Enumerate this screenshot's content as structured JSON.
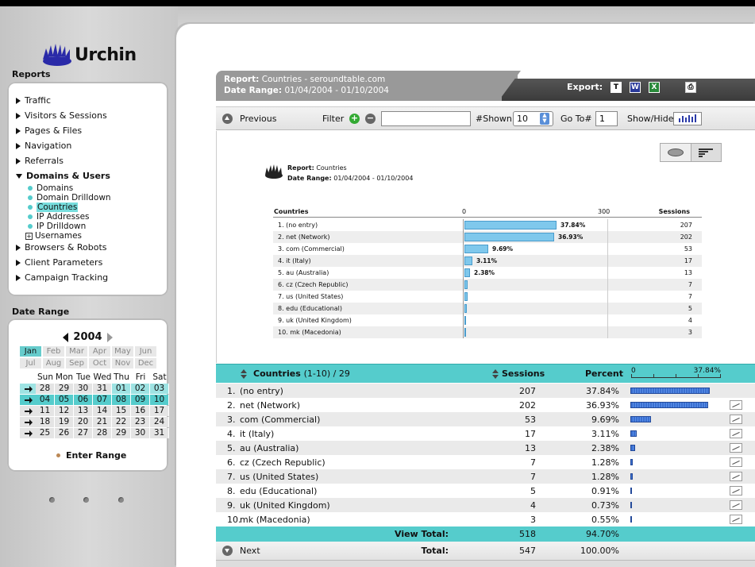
{
  "brand": {
    "name": "Urchin"
  },
  "sidebar": {
    "reports_heading": "Reports",
    "items": [
      {
        "label": "Traffic"
      },
      {
        "label": "Visitors & Sessions"
      },
      {
        "label": "Pages & Files"
      },
      {
        "label": "Navigation"
      },
      {
        "label": "Referrals"
      },
      {
        "label": "Domains & Users"
      },
      {
        "label": "Browsers & Robots"
      },
      {
        "label": "Client Parameters"
      },
      {
        "label": "Campaign Tracking"
      }
    ],
    "subitems": [
      {
        "label": "Domains"
      },
      {
        "label": "Domain Drilldown"
      },
      {
        "label": "Countries"
      },
      {
        "label": "IP Addresses"
      },
      {
        "label": "IP Drilldown"
      },
      {
        "label": "Usernames"
      }
    ],
    "date_range_heading": "Date Range",
    "year": "2004",
    "months": [
      "Jan",
      "Feb",
      "Mar",
      "Apr",
      "May",
      "Jun",
      "Jul",
      "Aug",
      "Sep",
      "Oct",
      "Nov",
      "Dec"
    ],
    "weekdays": [
      "Sun",
      "Mon",
      "Tue",
      "Wed",
      "Thu",
      "Fri",
      "Sat"
    ],
    "weeks": [
      [
        "28",
        "29",
        "30",
        "31",
        "01",
        "02",
        "03"
      ],
      [
        "04",
        "05",
        "06",
        "07",
        "08",
        "09",
        "10"
      ],
      [
        "11",
        "12",
        "13",
        "14",
        "15",
        "16",
        "17"
      ],
      [
        "18",
        "19",
        "20",
        "21",
        "22",
        "23",
        "24"
      ],
      [
        "25",
        "26",
        "27",
        "28",
        "29",
        "30",
        "31"
      ]
    ],
    "enter_range": "Enter Range"
  },
  "header": {
    "report_label": "Report",
    "report_value": "Countries - seroundtable.com",
    "range_label": "Date Range",
    "range_value": "01/04/2004 - 01/10/2004",
    "export_label": "Export:"
  },
  "toolbar": {
    "previous": "Previous",
    "filter": "Filter",
    "filter_value": "",
    "shown_label": "#Shown",
    "shown_value": "10",
    "goto_label": "Go To#",
    "goto_value": "1",
    "showhide": "Show/Hide"
  },
  "chart_data": {
    "type": "bar",
    "report_label": "Report:",
    "report_value": "Countries",
    "range_label": "Date Range:",
    "range_value": "01/04/2004 - 01/10/2004",
    "col_label": "Countries",
    "col_sessions": "Sessions",
    "xlim": [
      0,
      300
    ],
    "tick_labels": [
      "0",
      "300"
    ],
    "categories": [
      "1. (no entry)",
      "2. net (Network)",
      "3. com (Commercial)",
      "4. it (Italy)",
      "5. au (Australia)",
      "6. cz (Czech Republic)",
      "7. us (United States)",
      "8. edu (Educational)",
      "9. uk (United Kingdom)",
      "10. mk (Macedonia)"
    ],
    "values": [
      207,
      202,
      53,
      17,
      13,
      7,
      7,
      5,
      4,
      3
    ],
    "percent_labels": [
      "37.84%",
      "36.93%",
      "9.69%",
      "3.11%",
      "2.38%",
      "",
      "",
      "",
      "",
      ""
    ]
  },
  "table": {
    "col_name": "Countries",
    "col_range": "(1-10) / 29",
    "col_sessions": "Sessions",
    "col_percent": "Percent",
    "scale_min": "0",
    "scale_max": "37.84%",
    "rows": [
      {
        "n": "1.",
        "name": "(no entry)",
        "sessions": "207",
        "percent": "37.84%",
        "pct": 37.84
      },
      {
        "n": "2.",
        "name": "net (Network)",
        "sessions": "202",
        "percent": "36.93%",
        "pct": 36.93
      },
      {
        "n": "3.",
        "name": "com (Commercial)",
        "sessions": "53",
        "percent": "9.69%",
        "pct": 9.69
      },
      {
        "n": "4.",
        "name": "it (Italy)",
        "sessions": "17",
        "percent": "3.11%",
        "pct": 3.11
      },
      {
        "n": "5.",
        "name": "au (Australia)",
        "sessions": "13",
        "percent": "2.38%",
        "pct": 2.38
      },
      {
        "n": "6.",
        "name": "cz (Czech Republic)",
        "sessions": "7",
        "percent": "1.28%",
        "pct": 1.28
      },
      {
        "n": "7.",
        "name": "us (United States)",
        "sessions": "7",
        "percent": "1.28%",
        "pct": 1.28
      },
      {
        "n": "8.",
        "name": "edu (Educational)",
        "sessions": "5",
        "percent": "0.91%",
        "pct": 0.91
      },
      {
        "n": "9.",
        "name": "uk (United Kingdom)",
        "sessions": "4",
        "percent": "0.73%",
        "pct": 0.73
      },
      {
        "n": "10.",
        "name": "mk (Macedonia)",
        "sessions": "3",
        "percent": "0.55%",
        "pct": 0.55
      }
    ],
    "view_total_label": "View Total:",
    "view_total_sessions": "518",
    "view_total_percent": "94.70%",
    "next": "Next",
    "total_label": "Total:",
    "total_sessions": "547",
    "total_percent": "100.00%"
  },
  "colors": {
    "accent": "#55cccc",
    "bar": "#7fc8ec",
    "tablebar": "#3a6fd0"
  }
}
